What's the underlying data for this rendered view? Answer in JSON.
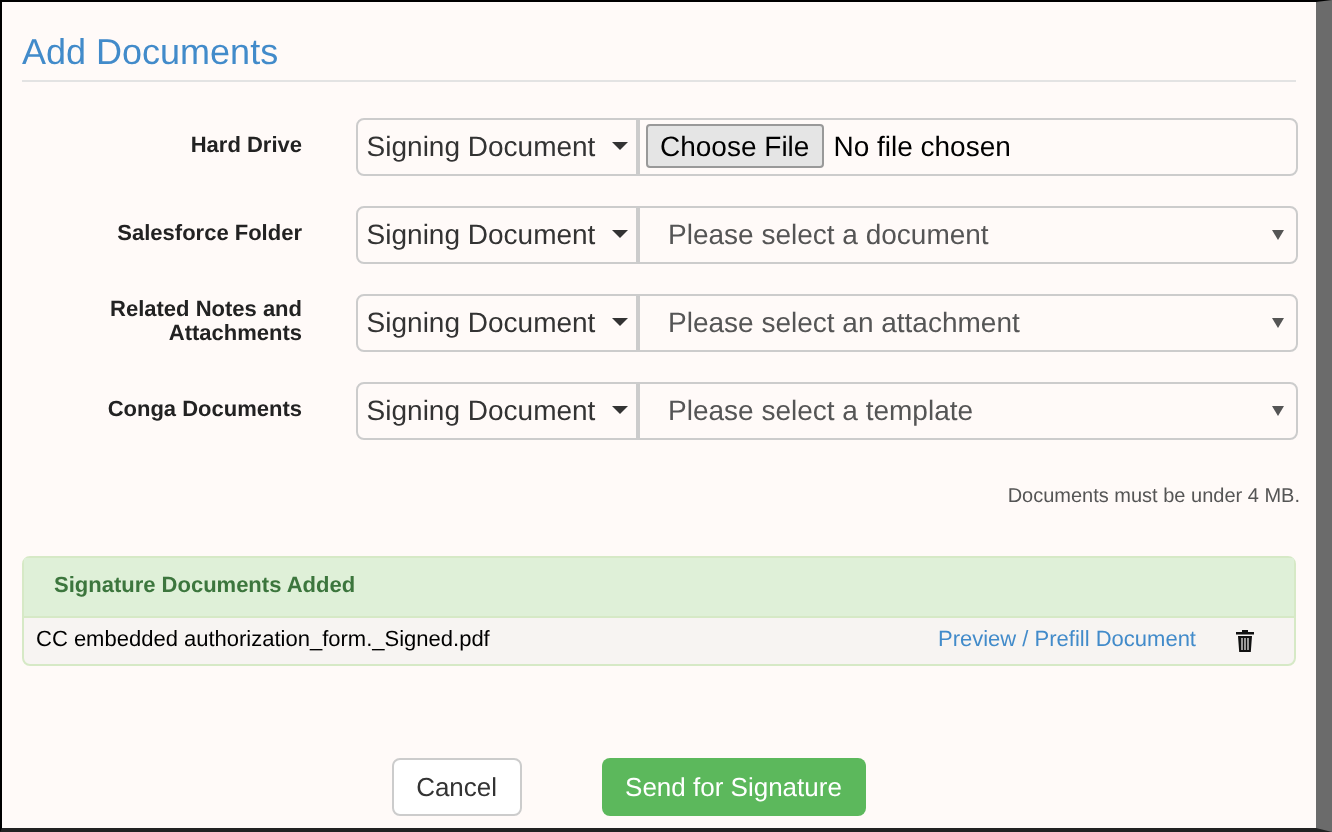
{
  "title": "Add Documents",
  "sources": [
    {
      "label": "Hard Drive",
      "type_button": "Signing Document",
      "kind": "file",
      "file_button": "Choose File",
      "file_status": "No file chosen"
    },
    {
      "label": "Salesforce Folder",
      "type_button": "Signing Document",
      "kind": "select",
      "placeholder": "Please select a document"
    },
    {
      "label": "Related Notes and Attachments",
      "type_button": "Signing Document",
      "kind": "select",
      "placeholder": "Please select an attachment"
    },
    {
      "label": "Conga Documents",
      "type_button": "Signing Document",
      "kind": "select",
      "placeholder": "Please select a template"
    }
  ],
  "size_note": "Documents must be under 4 MB.",
  "added_panel": {
    "heading": "Signature Documents Added",
    "documents": [
      {
        "name": "CC embedded authorization_form._Signed.pdf",
        "link": "Preview / Prefill Document"
      }
    ]
  },
  "buttons": {
    "cancel": "Cancel",
    "submit": "Send for Signature"
  }
}
